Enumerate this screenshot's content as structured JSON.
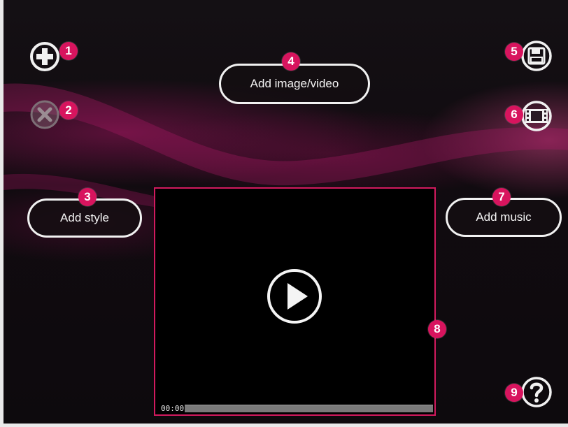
{
  "toolbar": {
    "add_label": "Add image/video",
    "add_style_label": "Add style",
    "add_music_label": "Add music"
  },
  "icons": {
    "add": "plus-icon",
    "remove": "close-icon",
    "save": "floppy-disk-icon",
    "film": "film-strip-icon",
    "play": "play-icon",
    "help": "help-icon"
  },
  "player": {
    "time": "00:00"
  },
  "badges": [
    "1",
    "2",
    "3",
    "4",
    "5",
    "6",
    "7",
    "8",
    "9"
  ],
  "colors": {
    "badge": "#d8145e",
    "video_border": "#d11a5e",
    "button_border": "#f1f1f1"
  }
}
